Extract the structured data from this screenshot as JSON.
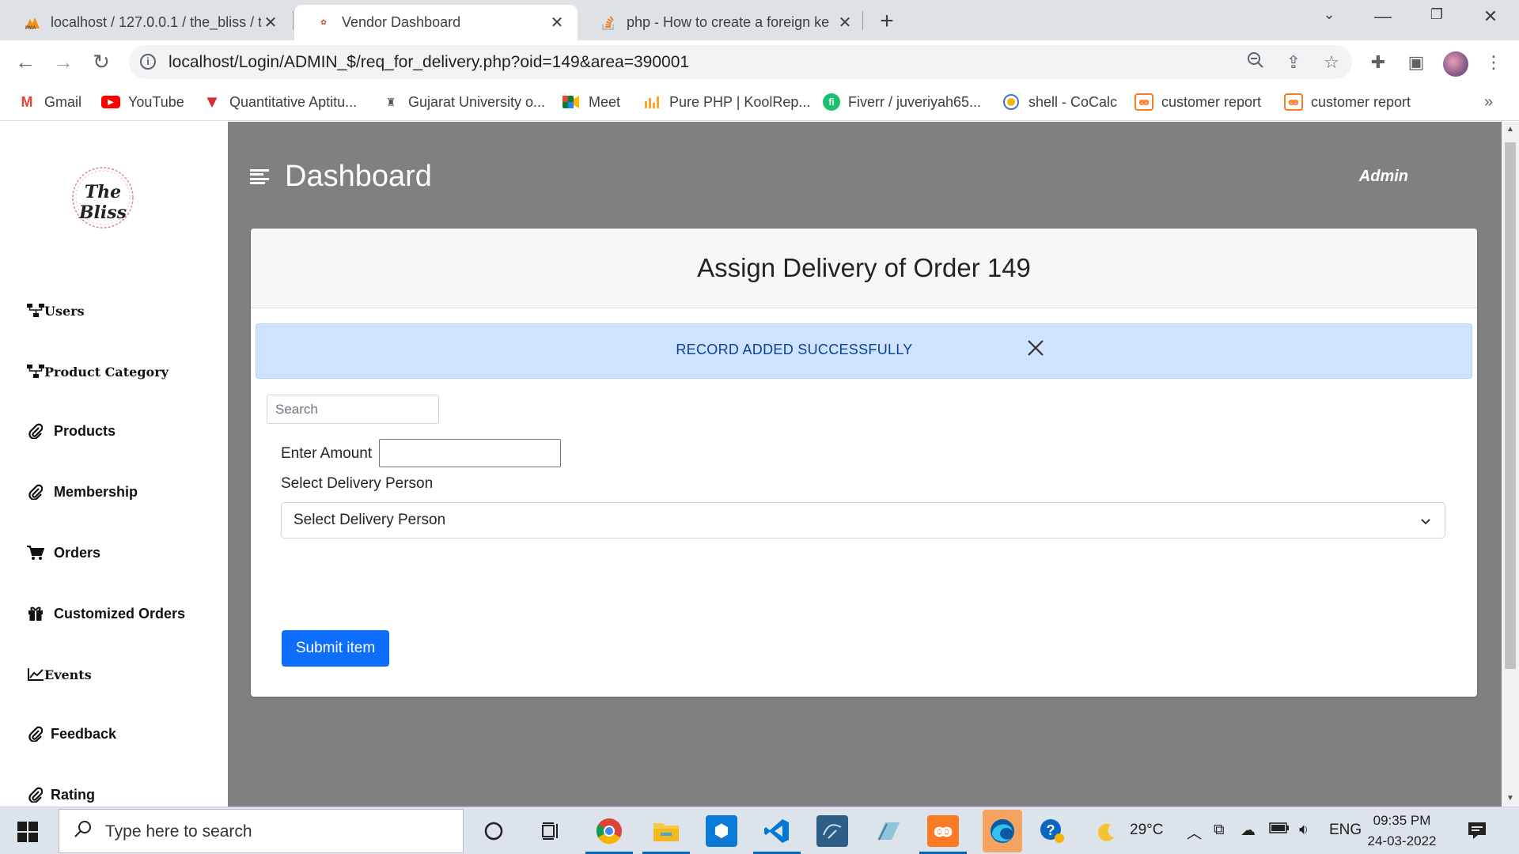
{
  "browser": {
    "tabs": [
      {
        "title": "localhost / 127.0.0.1 / the_bliss / t",
        "icon": "phpmyadmin-icon",
        "active": false
      },
      {
        "title": "Vendor Dashboard",
        "icon": "bliss-favicon-icon",
        "active": true
      },
      {
        "title": "php - How to create a foreign ke",
        "icon": "stackoverflow-icon",
        "active": false
      }
    ],
    "url": "localhost/Login/ADMIN_$/req_for_delivery.php?oid=149&area=390001",
    "bookmarks": [
      {
        "label": "Gmail",
        "icon": "gmail-icon",
        "color": "#ea4335"
      },
      {
        "label": "YouTube",
        "icon": "youtube-icon",
        "color": "#ff0000"
      },
      {
        "label": "Quantitative Aptitu...",
        "icon": "indiabix-icon",
        "color": "#d32f2f"
      },
      {
        "label": "Gujarat University o...",
        "icon": "gujarat-university-icon",
        "color": "#555555"
      },
      {
        "label": "Meet",
        "icon": "meet-icon",
        "color": "#00897b"
      },
      {
        "label": "Pure PHP | KoolRep...",
        "icon": "koolreport-icon",
        "color": "#f9a825"
      },
      {
        "label": "Fiverr / juveriyah65...",
        "icon": "fiverr-icon",
        "color": "#1dbf73"
      },
      {
        "label": "shell - CoCalc",
        "icon": "cocalc-icon",
        "color": "#f4b400"
      },
      {
        "label": "customer report",
        "icon": "xampp-icon",
        "color": "#fb7a24"
      },
      {
        "label": "customer report",
        "icon": "xampp-icon",
        "color": "#fb7a24"
      }
    ]
  },
  "sidebar": {
    "logo_text": "The Bliss",
    "items": [
      {
        "label": "Users",
        "icon": "sitemap-icon"
      },
      {
        "label": "Product Category",
        "icon": "sitemap-icon"
      },
      {
        "label": "Products",
        "icon": "paperclip-icon"
      },
      {
        "label": "Membership",
        "icon": "paperclip-icon"
      },
      {
        "label": "Orders",
        "icon": "cart-icon"
      },
      {
        "label": "Customized Orders",
        "icon": "gift-icon"
      },
      {
        "label": "Events",
        "icon": "chart-line-icon"
      },
      {
        "label": "Feedback",
        "icon": "paperclip-icon"
      },
      {
        "label": "Rating",
        "icon": "paperclip-icon"
      }
    ]
  },
  "header": {
    "title": "Dashboard",
    "user": "Admin"
  },
  "card": {
    "title": "Assign Delivery of Order 149",
    "alert": "RECORD ADDED SUCCESSFULLY",
    "search_placeholder": "Search",
    "amount_label": "Enter Amount",
    "amount_value": "",
    "delivery_label": "Select Delivery Person",
    "delivery_selected": "Select Delivery Person",
    "submit_label": "Submit item"
  },
  "taskbar": {
    "search_placeholder": "Type here to search",
    "weather": "29°C",
    "language": "ENG",
    "time": "09:35 PM",
    "date": "24-03-2022"
  },
  "colors": {
    "primary": "#0d6efd",
    "alert_bg": "#cfe2ff",
    "alert_text": "#084298",
    "main_bg": "#808080"
  }
}
